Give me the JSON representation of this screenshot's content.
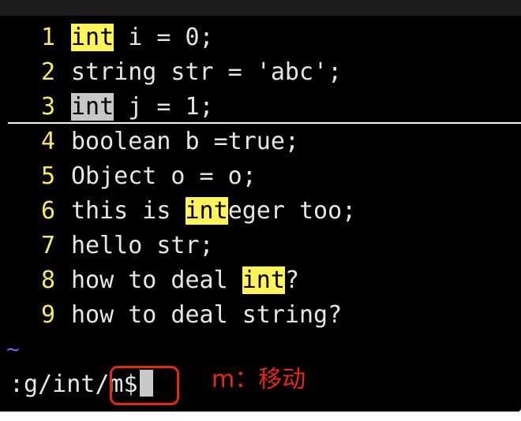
{
  "editor": {
    "lines": [
      {
        "num": "1",
        "segments": [
          {
            "text": "int",
            "hl": "yellow"
          },
          {
            "text": " i = 0;"
          }
        ]
      },
      {
        "num": "2",
        "segments": [
          {
            "text": "string str = 'abc';"
          }
        ]
      },
      {
        "num": "3",
        "segments": [
          {
            "text": "int",
            "hl": "gray"
          },
          {
            "text": " j = 1;"
          }
        ]
      },
      {
        "num": "4",
        "segments": [
          {
            "text": "boolean b =true;"
          }
        ]
      },
      {
        "num": "5",
        "segments": [
          {
            "text": "Object o = o;"
          }
        ]
      },
      {
        "num": "6",
        "segments": [
          {
            "text": "this is "
          },
          {
            "text": "int",
            "hl": "yellow"
          },
          {
            "text": "eger too;"
          }
        ]
      },
      {
        "num": "7",
        "segments": [
          {
            "text": "hello str;"
          }
        ]
      },
      {
        "num": "8",
        "segments": [
          {
            "text": "how to deal "
          },
          {
            "text": "int",
            "hl": "yellow"
          },
          {
            "text": "?"
          }
        ]
      },
      {
        "num": "9",
        "segments": [
          {
            "text": "how to deal string?"
          }
        ]
      }
    ],
    "tilde": "~",
    "command": ":g/int/m$"
  },
  "annotation": {
    "text": "m：移动",
    "color": "#e8290e"
  },
  "colors": {
    "line_number": "#f7e86b",
    "search_highlight": "#fff55b",
    "current_match": "#c7c7c7",
    "text": "#e6e6e6",
    "background": "#000000"
  }
}
